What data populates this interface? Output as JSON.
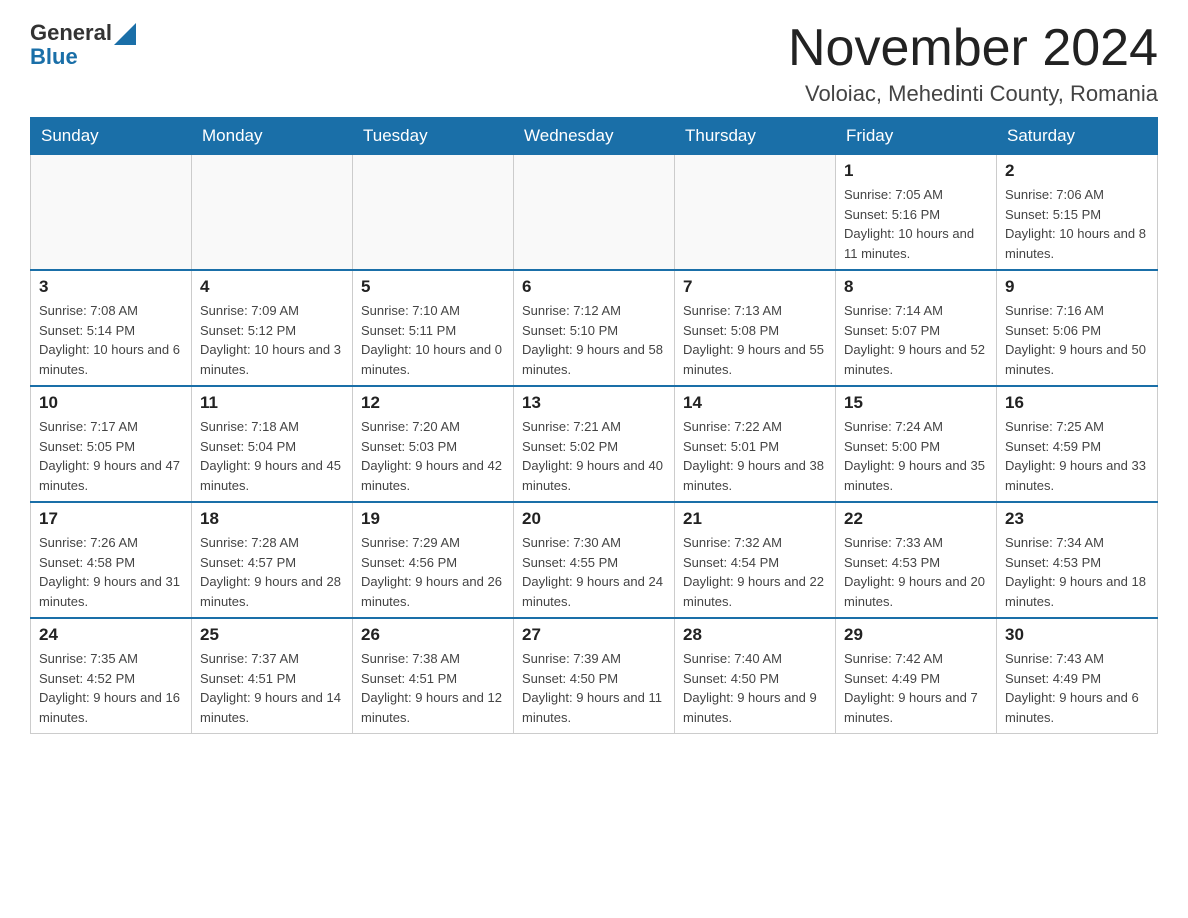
{
  "header": {
    "logo_general": "General",
    "logo_blue": "Blue",
    "month_title": "November 2024",
    "location": "Voloiac, Mehedinti County, Romania"
  },
  "days_of_week": [
    "Sunday",
    "Monday",
    "Tuesday",
    "Wednesday",
    "Thursday",
    "Friday",
    "Saturday"
  ],
  "weeks": [
    {
      "days": [
        {
          "date": "",
          "info": ""
        },
        {
          "date": "",
          "info": ""
        },
        {
          "date": "",
          "info": ""
        },
        {
          "date": "",
          "info": ""
        },
        {
          "date": "",
          "info": ""
        },
        {
          "date": "1",
          "info": "Sunrise: 7:05 AM\nSunset: 5:16 PM\nDaylight: 10 hours and 11 minutes."
        },
        {
          "date": "2",
          "info": "Sunrise: 7:06 AM\nSunset: 5:15 PM\nDaylight: 10 hours and 8 minutes."
        }
      ]
    },
    {
      "days": [
        {
          "date": "3",
          "info": "Sunrise: 7:08 AM\nSunset: 5:14 PM\nDaylight: 10 hours and 6 minutes."
        },
        {
          "date": "4",
          "info": "Sunrise: 7:09 AM\nSunset: 5:12 PM\nDaylight: 10 hours and 3 minutes."
        },
        {
          "date": "5",
          "info": "Sunrise: 7:10 AM\nSunset: 5:11 PM\nDaylight: 10 hours and 0 minutes."
        },
        {
          "date": "6",
          "info": "Sunrise: 7:12 AM\nSunset: 5:10 PM\nDaylight: 9 hours and 58 minutes."
        },
        {
          "date": "7",
          "info": "Sunrise: 7:13 AM\nSunset: 5:08 PM\nDaylight: 9 hours and 55 minutes."
        },
        {
          "date": "8",
          "info": "Sunrise: 7:14 AM\nSunset: 5:07 PM\nDaylight: 9 hours and 52 minutes."
        },
        {
          "date": "9",
          "info": "Sunrise: 7:16 AM\nSunset: 5:06 PM\nDaylight: 9 hours and 50 minutes."
        }
      ]
    },
    {
      "days": [
        {
          "date": "10",
          "info": "Sunrise: 7:17 AM\nSunset: 5:05 PM\nDaylight: 9 hours and 47 minutes."
        },
        {
          "date": "11",
          "info": "Sunrise: 7:18 AM\nSunset: 5:04 PM\nDaylight: 9 hours and 45 minutes."
        },
        {
          "date": "12",
          "info": "Sunrise: 7:20 AM\nSunset: 5:03 PM\nDaylight: 9 hours and 42 minutes."
        },
        {
          "date": "13",
          "info": "Sunrise: 7:21 AM\nSunset: 5:02 PM\nDaylight: 9 hours and 40 minutes."
        },
        {
          "date": "14",
          "info": "Sunrise: 7:22 AM\nSunset: 5:01 PM\nDaylight: 9 hours and 38 minutes."
        },
        {
          "date": "15",
          "info": "Sunrise: 7:24 AM\nSunset: 5:00 PM\nDaylight: 9 hours and 35 minutes."
        },
        {
          "date": "16",
          "info": "Sunrise: 7:25 AM\nSunset: 4:59 PM\nDaylight: 9 hours and 33 minutes."
        }
      ]
    },
    {
      "days": [
        {
          "date": "17",
          "info": "Sunrise: 7:26 AM\nSunset: 4:58 PM\nDaylight: 9 hours and 31 minutes."
        },
        {
          "date": "18",
          "info": "Sunrise: 7:28 AM\nSunset: 4:57 PM\nDaylight: 9 hours and 28 minutes."
        },
        {
          "date": "19",
          "info": "Sunrise: 7:29 AM\nSunset: 4:56 PM\nDaylight: 9 hours and 26 minutes."
        },
        {
          "date": "20",
          "info": "Sunrise: 7:30 AM\nSunset: 4:55 PM\nDaylight: 9 hours and 24 minutes."
        },
        {
          "date": "21",
          "info": "Sunrise: 7:32 AM\nSunset: 4:54 PM\nDaylight: 9 hours and 22 minutes."
        },
        {
          "date": "22",
          "info": "Sunrise: 7:33 AM\nSunset: 4:53 PM\nDaylight: 9 hours and 20 minutes."
        },
        {
          "date": "23",
          "info": "Sunrise: 7:34 AM\nSunset: 4:53 PM\nDaylight: 9 hours and 18 minutes."
        }
      ]
    },
    {
      "days": [
        {
          "date": "24",
          "info": "Sunrise: 7:35 AM\nSunset: 4:52 PM\nDaylight: 9 hours and 16 minutes."
        },
        {
          "date": "25",
          "info": "Sunrise: 7:37 AM\nSunset: 4:51 PM\nDaylight: 9 hours and 14 minutes."
        },
        {
          "date": "26",
          "info": "Sunrise: 7:38 AM\nSunset: 4:51 PM\nDaylight: 9 hours and 12 minutes."
        },
        {
          "date": "27",
          "info": "Sunrise: 7:39 AM\nSunset: 4:50 PM\nDaylight: 9 hours and 11 minutes."
        },
        {
          "date": "28",
          "info": "Sunrise: 7:40 AM\nSunset: 4:50 PM\nDaylight: 9 hours and 9 minutes."
        },
        {
          "date": "29",
          "info": "Sunrise: 7:42 AM\nSunset: 4:49 PM\nDaylight: 9 hours and 7 minutes."
        },
        {
          "date": "30",
          "info": "Sunrise: 7:43 AM\nSunset: 4:49 PM\nDaylight: 9 hours and 6 minutes."
        }
      ]
    }
  ]
}
